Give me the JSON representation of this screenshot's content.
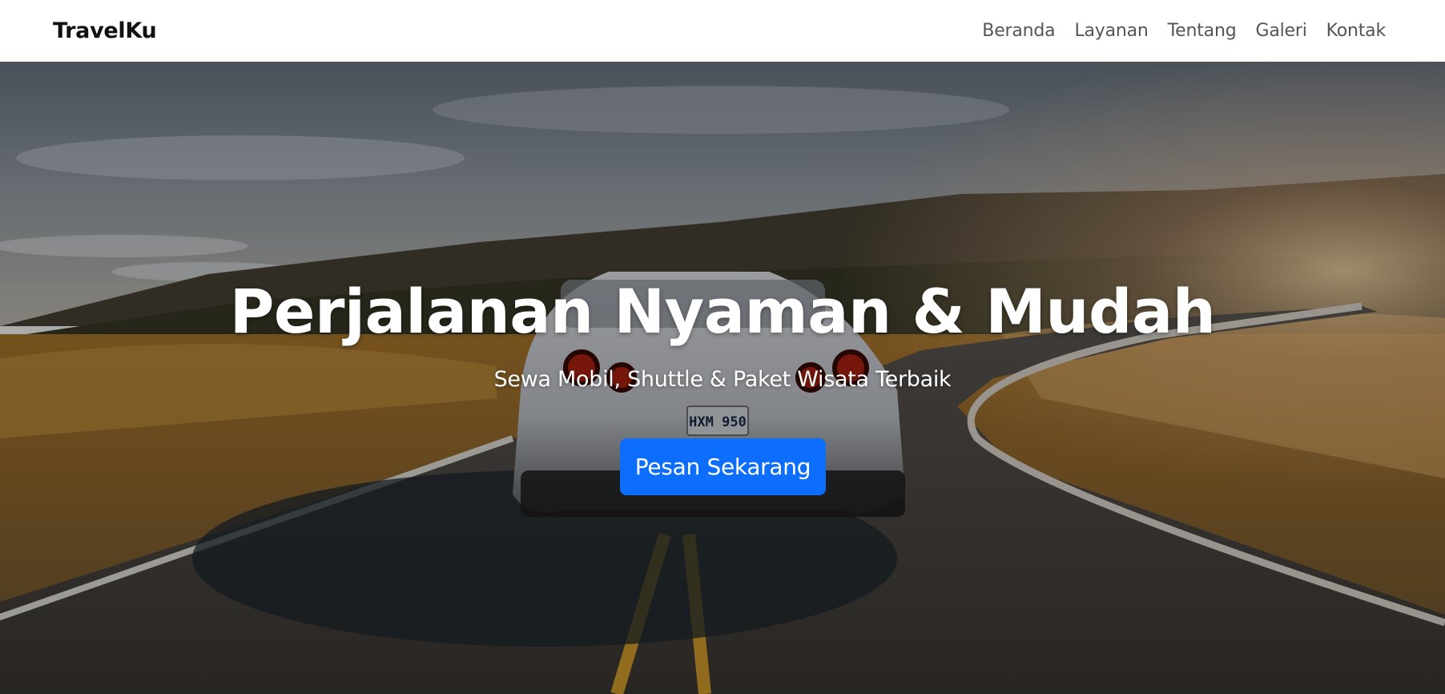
{
  "navbar": {
    "brand": "TravelKu",
    "links": [
      "Beranda",
      "Layanan",
      "Tentang",
      "Galeri",
      "Kontak"
    ]
  },
  "hero": {
    "title": "Perjalanan Nyaman & Mudah",
    "subtitle": "Sewa Mobil, Shuttle & Paket Wisata Terbaik",
    "cta_label": "Pesan Sekarang",
    "license_plate": "HXM 950"
  },
  "colors": {
    "primary": "#0d6efd",
    "navbar_bg": "#ffffff",
    "nav_link": "#555555"
  }
}
